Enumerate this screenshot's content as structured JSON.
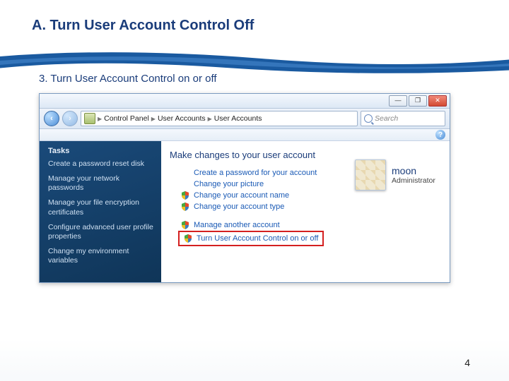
{
  "slide": {
    "title": "A. Turn User Account Control Off",
    "step": "3. Turn User Account Control on or off",
    "page_number": "4"
  },
  "window": {
    "buttons": {
      "min": "—",
      "max": "❐",
      "close": "✕"
    },
    "breadcrumb": {
      "root_icon": "control-panel-icon",
      "items": [
        "Control Panel",
        "User Accounts",
        "User Accounts"
      ]
    },
    "search_placeholder": "Search",
    "help_label": "?"
  },
  "sidebar": {
    "heading": "Tasks",
    "items": [
      "Create a password reset disk",
      "Manage your network passwords",
      "Manage your file encryption certificates",
      "Configure advanced user profile properties",
      "Change my environment variables"
    ]
  },
  "main": {
    "heading": "Make changes to your user account",
    "actions": [
      {
        "label": "Create a password for your account",
        "shield": false
      },
      {
        "label": "Change your picture",
        "shield": false
      },
      {
        "label": "Change your account name",
        "shield": true
      },
      {
        "label": "Change your account type",
        "shield": true
      }
    ],
    "actions2": [
      {
        "label": "Manage another account",
        "shield": true
      },
      {
        "label": "Turn User Account Control on or off",
        "shield": true,
        "highlight": true
      }
    ],
    "user": {
      "name": "moon",
      "role": "Administrator"
    }
  }
}
